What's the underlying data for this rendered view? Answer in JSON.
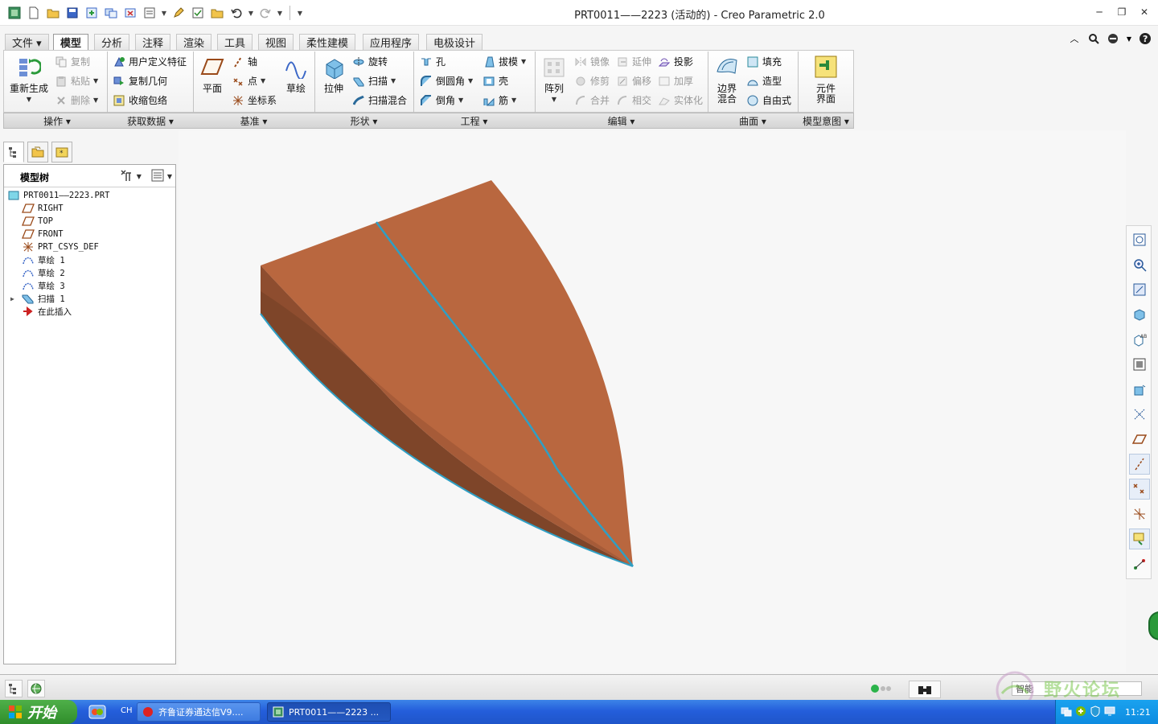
{
  "window": {
    "title": "PRT0011——2223 (活动的) - Creo Parametric 2.0"
  },
  "menu_tabs": [
    {
      "label": "文件 ▾"
    },
    {
      "label": "模型"
    },
    {
      "label": "分析"
    },
    {
      "label": "注释"
    },
    {
      "label": "渲染"
    },
    {
      "label": "工具"
    },
    {
      "label": "视图"
    },
    {
      "label": "柔性建模"
    },
    {
      "label": "应用程序"
    },
    {
      "label": "电极设计"
    }
  ],
  "ribbon": {
    "operations": {
      "regenerate": "重新生成",
      "copy": "复制",
      "paste": "粘贴",
      "delete": "删除"
    },
    "get_data": {
      "udf": "用户定义特征",
      "copy_geom": "复制几何",
      "shrinkwrap": "收缩包络"
    },
    "datum": {
      "plane": "平面",
      "axis": "轴",
      "point": "点",
      "csys": "坐标系",
      "sketch": "草绘"
    },
    "shapes": {
      "extrude": "拉伸",
      "revolve": "旋转",
      "sweep": "扫描",
      "swept_blend": "扫描混合"
    },
    "engineering": {
      "hole": "孔",
      "round": "倒圆角",
      "chamfer": "倒角",
      "draft": "拔模",
      "shell": "壳",
      "rib": "筋"
    },
    "editing": {
      "pattern": "阵列",
      "mirror": "镜像",
      "trim": "修剪",
      "merge": "合并",
      "extend": "延伸",
      "offset": "偏移",
      "intersect": "相交",
      "project": "投影",
      "thicken": "加厚",
      "solidify": "实体化"
    },
    "surfaces": {
      "boundary_blend": "边界混合",
      "fill": "填充",
      "style": "造型",
      "freestyle": "自由式"
    },
    "intent": {
      "component_interface": "元件界面"
    },
    "groups": [
      {
        "label": "操作 ▾"
      },
      {
        "label": "获取数据 ▾"
      },
      {
        "label": "基准 ▾"
      },
      {
        "label": "形状 ▾"
      },
      {
        "label": "工程 ▾"
      },
      {
        "label": "编辑 ▾"
      },
      {
        "label": "曲面 ▾"
      },
      {
        "label": "模型意图 ▾"
      }
    ]
  },
  "model_tree": {
    "title": "模型树",
    "items": [
      {
        "label": "PRT0011——2223.PRT",
        "icon": "part-icon"
      },
      {
        "label": "RIGHT",
        "icon": "datum-plane-icon"
      },
      {
        "label": "TOP",
        "icon": "datum-plane-icon"
      },
      {
        "label": "FRONT",
        "icon": "datum-plane-icon"
      },
      {
        "label": "PRT_CSYS_DEF",
        "icon": "csys-icon"
      },
      {
        "label": "草绘 1",
        "icon": "sketch-icon"
      },
      {
        "label": "草绘 2",
        "icon": "sketch-icon"
      },
      {
        "label": "草绘 3",
        "icon": "sketch-icon"
      },
      {
        "label": "扫描 1",
        "icon": "sweep-icon"
      },
      {
        "label": "在此插入",
        "icon": "insert-arrow-icon"
      }
    ]
  },
  "model": {
    "face_color_top": "#b9673f",
    "face_color_side": "#7e4529",
    "edge_color": "#2f9fc4"
  },
  "statusbar": {
    "filter": "智能"
  },
  "watermark": {
    "text": "野火论坛"
  },
  "taskbar": {
    "start": "开始",
    "lang": "CH",
    "tasks": [
      {
        "label": "齐鲁证券通达信V9...."
      },
      {
        "label": "PRT0011——2223 ..."
      }
    ],
    "clock": "11:21"
  }
}
